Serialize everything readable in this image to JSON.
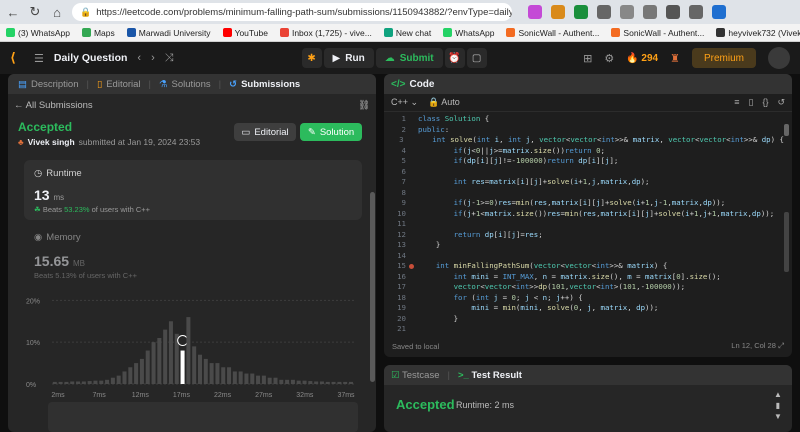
{
  "browser": {
    "url": "https://leetcode.com/problems/minimum-falling-path-sum/submissions/1150943882/?envType=daily-questi..."
  },
  "bookmarks": [
    {
      "label": "(3) WhatsApp",
      "color": "#25d366"
    },
    {
      "label": "Maps",
      "color": "#34a853"
    },
    {
      "label": "Marwadi University",
      "color": "#1a56a8"
    },
    {
      "label": "YouTube",
      "color": "#ff0000"
    },
    {
      "label": "Inbox (1,725) - vive...",
      "color": "#ea4335"
    },
    {
      "label": "New chat",
      "color": "#10a37f"
    },
    {
      "label": "WhatsApp",
      "color": "#25d366"
    },
    {
      "label": "SonicWall - Authent...",
      "color": "#f36b21"
    },
    {
      "label": "SonicWall - Authent...",
      "color": "#f36b21"
    },
    {
      "label": "heyvivek732 (Vivek...",
      "color": "#333333"
    }
  ],
  "topbar": {
    "title": "Daily Question",
    "run": "Run",
    "submit": "Submit",
    "streak": "294",
    "premium": "Premium"
  },
  "left": {
    "tabs": [
      "Description",
      "Editorial",
      "Solutions",
      "Submissions"
    ],
    "back": "All Submissions",
    "status": "Accepted",
    "user": "Vivek singh",
    "submitted": "submitted at Jan 19, 2024 23:53",
    "editorial_btn": "Editorial",
    "solution_btn": "Solution",
    "runtime": {
      "label": "Runtime",
      "value": "13",
      "unit": "ms",
      "beats_prefix": "Beats",
      "beats_pct": "53.23%",
      "beats_suffix": "of users with C++"
    },
    "memory": {
      "label": "Memory",
      "value": "15.65",
      "unit": "MB",
      "beats": "Beats 5.13% of users with C++"
    }
  },
  "chart_data": {
    "type": "bar",
    "ylabels": [
      "20%",
      "10%",
      "0%"
    ],
    "xlabels": [
      "2ms",
      "7ms",
      "12ms",
      "17ms",
      "22ms",
      "27ms",
      "32ms",
      "37ms"
    ],
    "values": [
      0.5,
      0.5,
      0.5,
      0.6,
      0.6,
      0.6,
      0.7,
      0.8,
      0.8,
      1.0,
      1.5,
      2,
      3,
      4,
      5,
      6,
      8,
      10,
      11,
      13,
      15,
      12,
      8,
      16,
      9,
      7,
      6,
      5,
      5,
      4,
      4,
      3,
      3,
      2.5,
      2.5,
      2,
      2,
      1.5,
      1.5,
      1,
      1,
      1,
      0.8,
      0.8,
      0.7,
      0.6,
      0.6,
      0.5,
      0.5,
      0.5,
      0.5,
      0.5
    ],
    "highlight_index": 22,
    "ylim": [
      0,
      22
    ]
  },
  "code": {
    "header": "Code",
    "language": "C++",
    "mode": "Auto",
    "footer_left": "Saved to local",
    "footer_right": "Ln 12, Col 28"
  },
  "test": {
    "tab1": "Testcase",
    "tab2": "Test Result",
    "status": "Accepted",
    "runtime": "Runtime: 2 ms"
  }
}
